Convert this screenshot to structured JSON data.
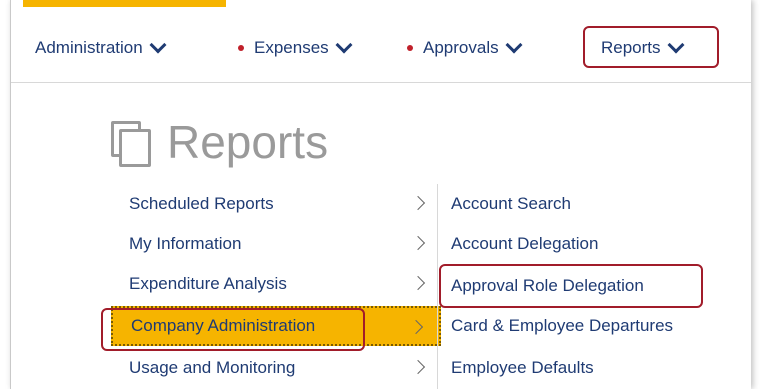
{
  "nav": {
    "items": [
      {
        "label": "Administration",
        "dot": false
      },
      {
        "label": "Expenses",
        "dot": true
      },
      {
        "label": "Approvals",
        "dot": true
      },
      {
        "label": "Reports",
        "dot": false
      }
    ]
  },
  "page_title": "Reports",
  "menu": {
    "left": [
      {
        "label": "Scheduled Reports"
      },
      {
        "label": "My Information"
      },
      {
        "label": "Expenditure Analysis"
      },
      {
        "label": "Company Administration",
        "active": true
      },
      {
        "label": "Usage and Monitoring"
      }
    ],
    "right": [
      {
        "label": "Account Search"
      },
      {
        "label": "Account Delegation"
      },
      {
        "label": "Approval Role Delegation"
      },
      {
        "label": "Card & Employee Departures"
      },
      {
        "label": "Employee Defaults"
      }
    ]
  },
  "colors": {
    "accent": "#f6b400",
    "nav_text": "#1f3b73",
    "highlight_border": "#a11c2a",
    "status_dot": "#c0202a"
  }
}
